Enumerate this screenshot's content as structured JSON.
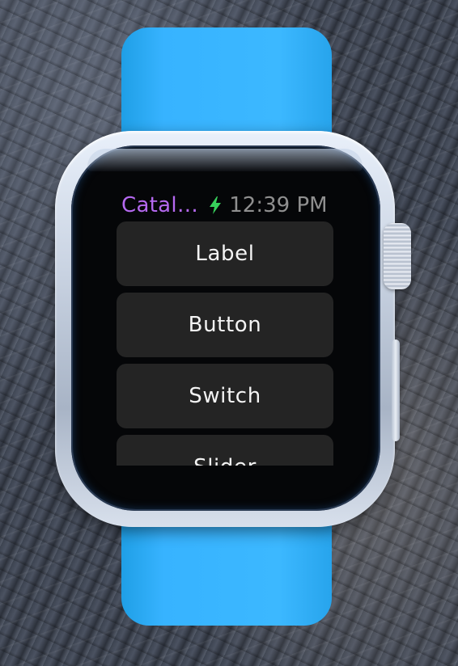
{
  "status_bar": {
    "app_title": "Catal…",
    "charging_icon": "lightning-bolt-icon",
    "time": "12:39 PM"
  },
  "colors": {
    "app_title": "#b569f0",
    "charging": "#37d05b",
    "cell_background": "#242424",
    "band": "#3cb8ff"
  },
  "list": {
    "items": [
      {
        "label": "Label"
      },
      {
        "label": "Button"
      },
      {
        "label": "Switch"
      },
      {
        "label": "Slider"
      }
    ]
  }
}
